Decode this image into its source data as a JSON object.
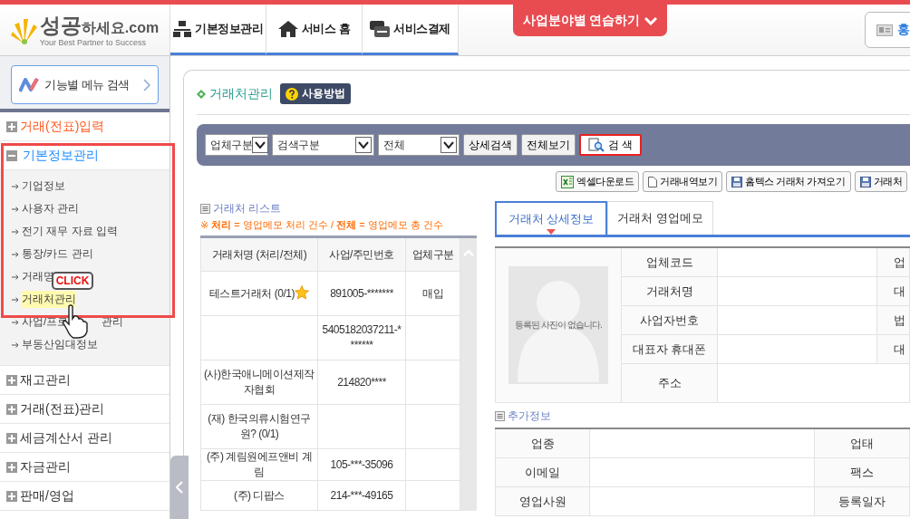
{
  "logo": {
    "main": "성공",
    "rest": "하세요.com",
    "tagline": "Your Best Partner to Success"
  },
  "nav_tabs": [
    {
      "label": "기본정보관리",
      "kind": "org"
    },
    {
      "label": "서비스 홈",
      "kind": "home"
    },
    {
      "label": "서비스결제",
      "kind": "card"
    }
  ],
  "practice_button": "사업분야별 연습하기",
  "profile_button": "홍",
  "menu_search": "기능별 메뉴 검색",
  "sidebar": {
    "items": [
      {
        "label": "거래(전표)입력",
        "color": "#ff5a1f",
        "expanded": false
      },
      {
        "label": "기본정보관리",
        "color": "#1a8cff",
        "expanded": true,
        "children": [
          {
            "label": "기업정보",
            "selected": false
          },
          {
            "label": "사용자 관리",
            "selected": false
          },
          {
            "label": "전기 재무 자료 입력",
            "selected": false
          },
          {
            "label": "통장/카드 관리",
            "selected": false
          },
          {
            "label": "거래명",
            "selected": false
          },
          {
            "label": "거래처관리",
            "selected": true
          },
          {
            "label": "사업/프로",
            "tail": "관리",
            "selected": false
          },
          {
            "label": "부동산임대정보",
            "selected": false
          }
        ]
      },
      {
        "label": "재고관리",
        "color": "#333333",
        "expanded": false
      },
      {
        "label": "거래(전표)관리",
        "color": "#333333",
        "expanded": false
      },
      {
        "label": "세금계산서 관리",
        "color": "#333333",
        "expanded": false
      },
      {
        "label": "자금관리",
        "color": "#333333",
        "expanded": false
      },
      {
        "label": "판매/영업",
        "color": "#333333",
        "expanded": false
      }
    ]
  },
  "click_label": "CLICK",
  "page_title": "거래처관리",
  "help_button": "사용방법",
  "search": {
    "selects": [
      "업체구분",
      "검색구분",
      "전체"
    ],
    "buttons": [
      "상세검색",
      "전체보기"
    ],
    "search_button": "검 색"
  },
  "actions": [
    {
      "label": "엑셀다운로드",
      "kind": "excel"
    },
    {
      "label": "거래내역보기",
      "kind": "doc"
    },
    {
      "label": "홈텍스 거래처 가져오기",
      "kind": "disk"
    },
    {
      "label": "거래처",
      "kind": "disk"
    }
  ],
  "list": {
    "title": "거래처 리스트",
    "note": "※ **처리** = 영업메모 처리 건수 / **전체** = 영업메모 총 건수",
    "columns": [
      "거래처명 (처리/전체)",
      "사업/주민번호",
      "업체구분"
    ],
    "rows": [
      {
        "name": "테스트거래처 (0/1)",
        "favorite": true,
        "number": "891005-*******",
        "type": "매입"
      },
      {
        "favorite": false,
        "number": "5405182037211-*******"
      },
      {
        "name": "(사)한국애니메이션제작자협회",
        "favorite": false,
        "number": "214820****"
      },
      {
        "name": "(재) 한국의류시험연구원? (0/1)",
        "favorite": false
      },
      {
        "name": "(주) 계림원에프앤비 계림",
        "favorite": false,
        "number": "105-***-35096"
      },
      {
        "name": "(주) 디팝스",
        "favorite": false,
        "number": "214-***-49165"
      }
    ]
  },
  "detail_tabs": [
    {
      "label": "거래처 상세정보",
      "selected": true
    },
    {
      "label": "거래처 영업메모",
      "selected": false
    }
  ],
  "photo": {
    "caption": "등록된 사진이 없습니다."
  },
  "detail_fields": [
    {
      "label": "업체코드",
      "label_2": "업"
    },
    {
      "label": "거래처명",
      "label_2": "대"
    },
    {
      "label": "사업자번호",
      "label_2": "법"
    },
    {
      "label": "대표자 휴대폰",
      "label_2": "대"
    },
    {
      "label": "주소"
    }
  ],
  "extra": {
    "title": "추가정보",
    "rows": [
      {
        "label": "업종",
        "label_2": "업태"
      },
      {
        "label": "이메일",
        "label_2": "팩스"
      },
      {
        "label": "영업사원",
        "label_2": "등록일자"
      }
    ]
  }
}
